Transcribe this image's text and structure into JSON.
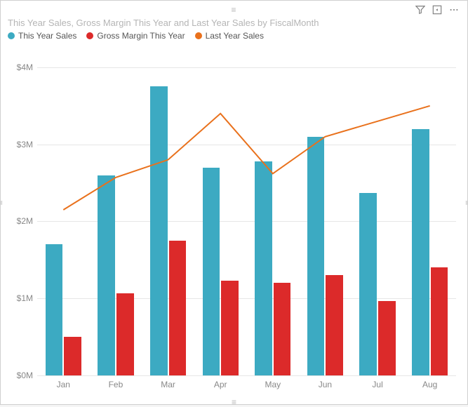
{
  "title": "This Year Sales, Gross Margin This Year and Last Year Sales by FiscalMonth",
  "toolbar": {
    "filter_icon": "filter-icon",
    "focus_icon": "focus-mode-icon",
    "more_icon": "more-icon"
  },
  "legend": [
    {
      "label": "This Year Sales",
      "color": "#3caac2",
      "kind": "bar"
    },
    {
      "label": "Gross Margin This Year",
      "color": "#dc2a2a",
      "kind": "bar"
    },
    {
      "label": "Last Year Sales",
      "color": "#e9711c",
      "kind": "line"
    }
  ],
  "y_axis": {
    "ticks": [
      {
        "value": 0,
        "label": "$0M"
      },
      {
        "value": 1000000,
        "label": "$1M"
      },
      {
        "value": 2000000,
        "label": "$2M"
      },
      {
        "value": 3000000,
        "label": "$3M"
      },
      {
        "value": 4000000,
        "label": "$4M"
      }
    ],
    "max": 4200000
  },
  "chart_data": {
    "type": "bar+line",
    "title": "This Year Sales, Gross Margin This Year and Last Year Sales by FiscalMonth",
    "xlabel": "FiscalMonth",
    "ylabel": "",
    "ylim": [
      0,
      4200000
    ],
    "categories": [
      "Jan",
      "Feb",
      "Mar",
      "Apr",
      "May",
      "Jun",
      "Jul",
      "Aug"
    ],
    "series": [
      {
        "name": "This Year Sales",
        "type": "bar",
        "color": "#3caac2",
        "values": [
          1700000,
          2600000,
          3750000,
          2700000,
          2780000,
          3100000,
          2370000,
          3200000
        ]
      },
      {
        "name": "Gross Margin This Year",
        "type": "bar",
        "color": "#dc2a2a",
        "values": [
          500000,
          1070000,
          1750000,
          1230000,
          1200000,
          1300000,
          970000,
          1400000
        ]
      },
      {
        "name": "Last Year Sales",
        "type": "line",
        "color": "#e9711c",
        "values": [
          2150000,
          2570000,
          2800000,
          3400000,
          2620000,
          3100000,
          3300000,
          3500000
        ]
      }
    ]
  }
}
